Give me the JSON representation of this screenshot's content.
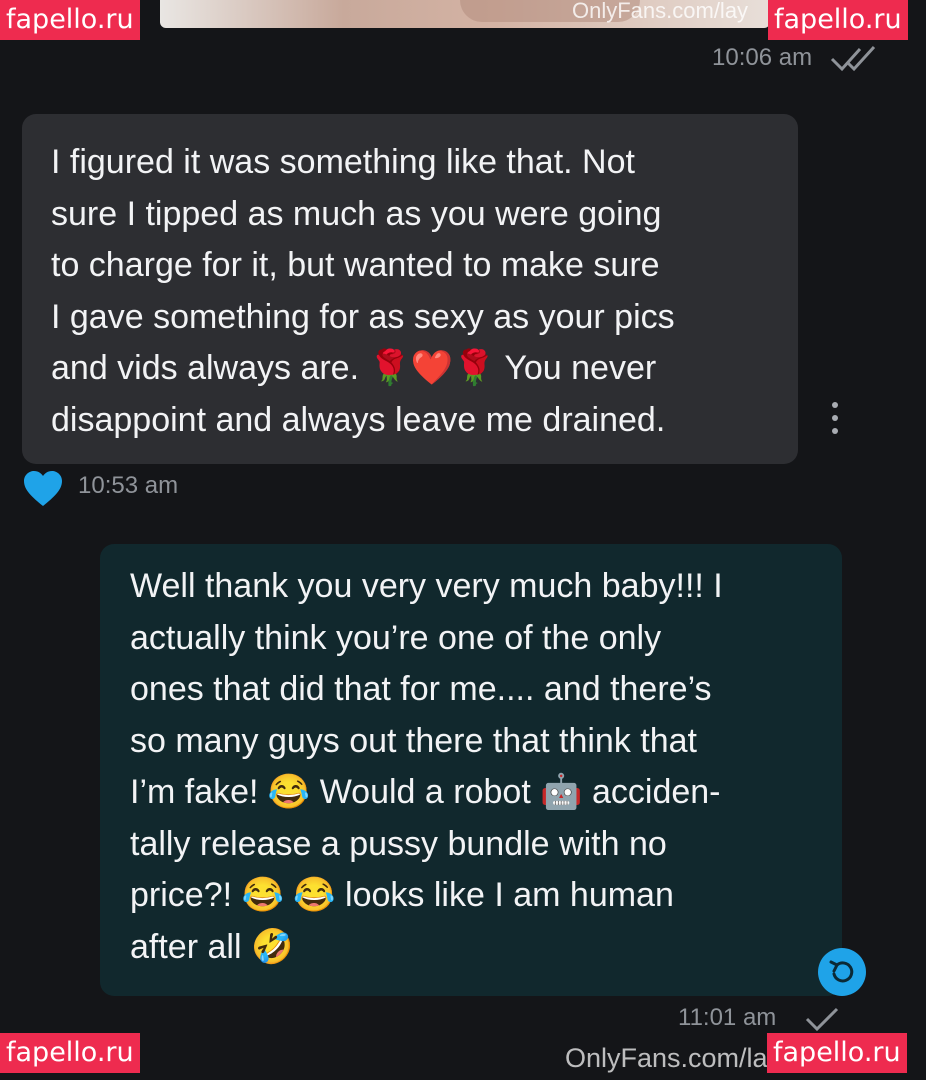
{
  "watermarks": {
    "badge_top_left": "fapello.ru",
    "badge_top_right": "fapello.ru",
    "badge_bottom_left": "fapello.ru",
    "badge_bottom_right": "fapello.ru",
    "site_top": "OnlyFans.com/lay",
    "site_bottom": "OnlyFans.com/la"
  },
  "messages": [
    {
      "direction": "sent",
      "time": "10:06 am",
      "status_icon": "double-check-icon"
    },
    {
      "direction": "received",
      "lines": [
        "I figured it was something like that. Not",
        "sure I tipped as much as you were going",
        "to charge for it, but wanted to make sure",
        "I gave something for as sexy as your pics",
        "and vids always are. 🌹❤️🌹 You never",
        "disappoint and always leave me drained."
      ],
      "time": "10:53 am",
      "liked": true,
      "like_icon": "heart-icon",
      "menu_icon": "more-vertical-icon"
    },
    {
      "direction": "sent",
      "lines": [
        "Well thank you very very much baby!!! I",
        "actually think you’re one of the only",
        "ones that did that for me.... and there’s",
        "so many guys out there that think that",
        "I’m fake! 😂 Would a robot 🤖 acciden-",
        "tally release a pussy bundle with no",
        "price?! 😂 😂 looks like I am human",
        "after all 🤣"
      ],
      "time": "11:01 am",
      "status_icon": "check-icon",
      "action_icon": "replay-icon"
    }
  ],
  "colors": {
    "background": "#141518",
    "incoming_bubble": "#2d2e32",
    "outgoing_bubble": "#11282d",
    "accent_blue": "#1fa3e8",
    "badge": "#ee2b4f",
    "timestamp": "#8f9399"
  }
}
